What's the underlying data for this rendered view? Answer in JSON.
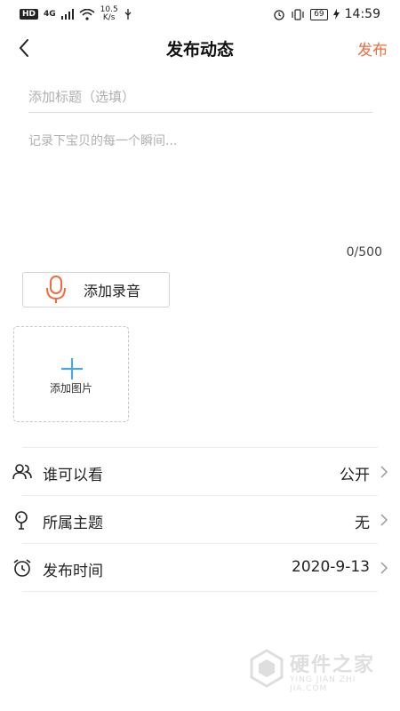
{
  "status_bar": {
    "hd": "HD",
    "network": "4G",
    "speed_value": "10.5",
    "speed_unit": "K/s",
    "battery": "69",
    "time": "14:59"
  },
  "nav": {
    "title": "发布动态",
    "publish_label": "发布"
  },
  "form": {
    "title_placeholder": "添加标题（选填）",
    "title_value": "",
    "content_placeholder": "记录下宝贝的每一个瞬间...",
    "content_value": "",
    "counter": "0/500"
  },
  "audio": {
    "label": "添加录音"
  },
  "image": {
    "label": "添加图片"
  },
  "settings": [
    {
      "icon": "people-icon",
      "label": "谁可以看",
      "value": "公开"
    },
    {
      "icon": "pin-icon",
      "label": "所属主题",
      "value": "无"
    },
    {
      "icon": "alarm-clock-icon",
      "label": "发布时间",
      "value": "2020-9-13"
    }
  ],
  "watermark": {
    "title": "硬件之家",
    "subtitle": "YING JIAN ZHI JIA.COM"
  },
  "colors": {
    "accent": "#ef6c3e",
    "plus": "#4aa8e0"
  }
}
